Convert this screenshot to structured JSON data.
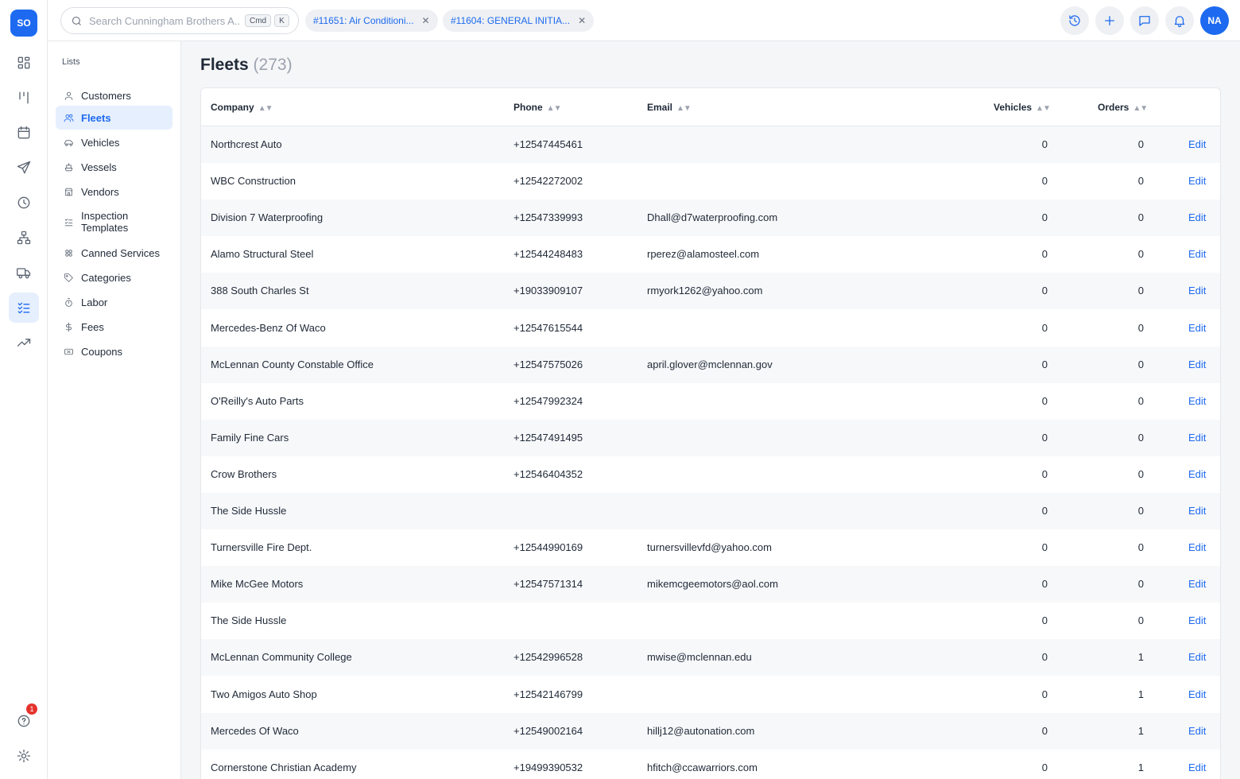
{
  "app": {
    "logo": "SO"
  },
  "rail": {
    "help_badge": "1"
  },
  "search": {
    "placeholder": "Search Cunningham Brothers A...",
    "kbd_1": "Cmd",
    "kbd_2": "K"
  },
  "tabs": [
    {
      "label": "#11651: Air Conditioni..."
    },
    {
      "label": "#11604: GENERAL INITIA..."
    }
  ],
  "user": {
    "initials": "NA"
  },
  "lists": {
    "title": "Lists",
    "items": [
      {
        "label": "Customers"
      },
      {
        "label": "Fleets"
      },
      {
        "label": "Vehicles"
      },
      {
        "label": "Vessels"
      },
      {
        "label": "Vendors"
      },
      {
        "label": "Inspection Templates"
      },
      {
        "label": "Canned Services"
      },
      {
        "label": "Categories"
      },
      {
        "label": "Labor"
      },
      {
        "label": "Fees"
      },
      {
        "label": "Coupons"
      }
    ]
  },
  "page": {
    "title": "Fleets",
    "count": "(273)"
  },
  "table": {
    "columns": {
      "company": "Company",
      "phone": "Phone",
      "email": "Email",
      "vehicles": "Vehicles",
      "orders": "Orders",
      "sort_glyph": "▲▼"
    },
    "edit_label": "Edit",
    "rows": [
      {
        "company": "Northcrest Auto",
        "phone": "+12547445461",
        "email": "",
        "vehicles": "0",
        "orders": "0"
      },
      {
        "company": "WBC Construction",
        "phone": "+12542272002",
        "email": "",
        "vehicles": "0",
        "orders": "0"
      },
      {
        "company": "Division 7 Waterproofing",
        "phone": "+12547339993",
        "email": "Dhall@d7waterproofing.com",
        "vehicles": "0",
        "orders": "0"
      },
      {
        "company": "Alamo Structural Steel",
        "phone": "+12544248483",
        "email": "rperez@alamosteel.com",
        "vehicles": "0",
        "orders": "0"
      },
      {
        "company": "388 South Charles St",
        "phone": "+19033909107",
        "email": "rmyork1262@yahoo.com",
        "vehicles": "0",
        "orders": "0"
      },
      {
        "company": "Mercedes-Benz Of Waco",
        "phone": "+12547615544",
        "email": "",
        "vehicles": "0",
        "orders": "0"
      },
      {
        "company": "McLennan County Constable Office",
        "phone": "+12547575026",
        "email": "april.glover@mclennan.gov",
        "vehicles": "0",
        "orders": "0"
      },
      {
        "company": "O'Reilly's Auto Parts",
        "phone": "+12547992324",
        "email": "",
        "vehicles": "0",
        "orders": "0"
      },
      {
        "company": "Family Fine Cars",
        "phone": "+12547491495",
        "email": "",
        "vehicles": "0",
        "orders": "0"
      },
      {
        "company": "Crow Brothers",
        "phone": "+12546404352",
        "email": "",
        "vehicles": "0",
        "orders": "0"
      },
      {
        "company": "The Side Hussle",
        "phone": "",
        "email": "",
        "vehicles": "0",
        "orders": "0"
      },
      {
        "company": "Turnersville Fire Dept.",
        "phone": "+12544990169",
        "email": "turnersvillevfd@yahoo.com",
        "vehicles": "0",
        "orders": "0"
      },
      {
        "company": "Mike McGee Motors",
        "phone": "+12547571314",
        "email": "mikemcgeemotors@aol.com",
        "vehicles": "0",
        "orders": "0"
      },
      {
        "company": "The Side Hussle",
        "phone": "",
        "email": "",
        "vehicles": "0",
        "orders": "0"
      },
      {
        "company": "McLennan Community College",
        "phone": "+12542996528",
        "email": "mwise@mclennan.edu",
        "vehicles": "0",
        "orders": "1"
      },
      {
        "company": "Two Amigos Auto Shop",
        "phone": "+12542146799",
        "email": "",
        "vehicles": "0",
        "orders": "1"
      },
      {
        "company": "Mercedes Of Waco",
        "phone": "+12549002164",
        "email": "hillj12@autonation.com",
        "vehicles": "0",
        "orders": "1"
      },
      {
        "company": "Cornerstone Christian Academy",
        "phone": "+19499390532",
        "email": "hfitch@ccawarriors.com",
        "vehicles": "0",
        "orders": "1"
      }
    ]
  }
}
